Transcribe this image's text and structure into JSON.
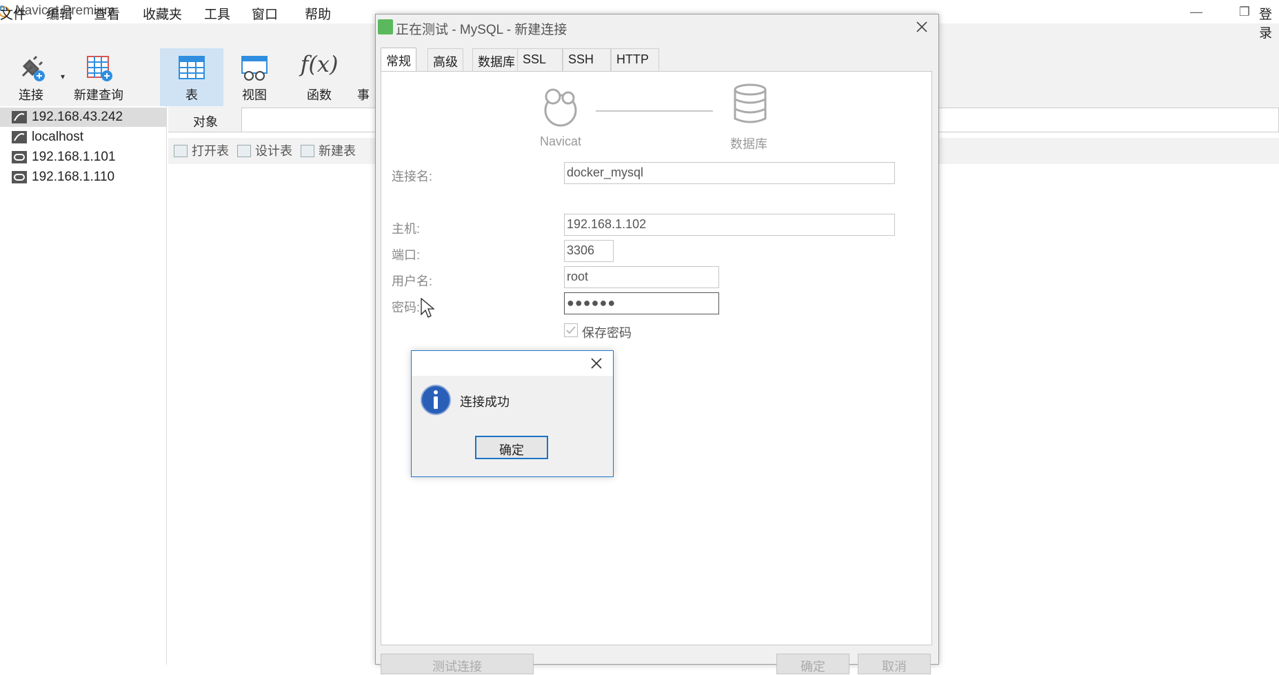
{
  "app": {
    "title": "Navicat Premium",
    "minimize_glyph": "—",
    "restore_glyph": "❐",
    "login_label": "登录"
  },
  "menu": [
    "文件",
    "编辑",
    "查看",
    "收藏夹",
    "工具",
    "窗口",
    "帮助"
  ],
  "toolbar": {
    "connect": "连接",
    "new_query": "新建查询",
    "table": "表",
    "view": "视图",
    "function": "函数",
    "partial_next": "事"
  },
  "sidebar": {
    "connections": [
      {
        "label": "192.168.43.242",
        "icon": "mysql-icon"
      },
      {
        "label": "localhost",
        "icon": "mysql-icon"
      },
      {
        "label": "192.168.1.101",
        "icon": "oracle-icon"
      },
      {
        "label": "192.168.1.110",
        "icon": "oracle-icon"
      }
    ]
  },
  "objects": {
    "tab_label": "对象",
    "tools": [
      "打开表",
      "设计表",
      "新建表"
    ]
  },
  "dialog": {
    "title": "正在测试 - MySQL - 新建连接",
    "tabs": [
      "常规",
      "高级",
      "数据库",
      "SSL",
      "SSH",
      "HTTP"
    ],
    "diagram_left": "Navicat",
    "diagram_right": "数据库",
    "fields": {
      "conn_name_label": "连接名:",
      "conn_name": "docker_mysql",
      "host_label": "主机:",
      "host": "192.168.1.102",
      "port_label": "端口:",
      "port": "3306",
      "user_label": "用户名:",
      "user": "root",
      "pass_label": "密码:",
      "pass": "●●●●●●",
      "save_pass_label": "保存密码",
      "save_pass_checked": true
    },
    "buttons": {
      "test": "测试连接",
      "ok": "确定",
      "cancel": "取消"
    }
  },
  "message": {
    "text": "连接成功",
    "ok": "确定"
  },
  "colors": {
    "accent": "#1a72c4",
    "selected_tool": "#cfe3f5",
    "mysql_green": "#5cb85c"
  }
}
